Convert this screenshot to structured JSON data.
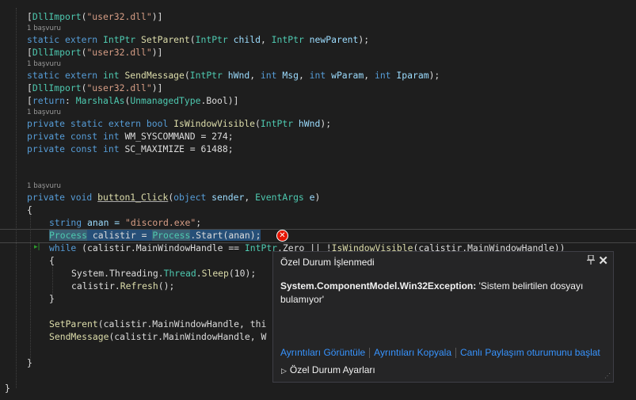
{
  "code": {
    "l1": {
      "b1": "[",
      "attr": "DllImport",
      "b2": "(",
      "str": "\"user32.dll\"",
      "b3": ")]"
    },
    "r1": "1 başvuru",
    "l2": {
      "kw": "static extern ",
      "ty": "IntPtr ",
      "fn": "SetParent",
      "a": "(",
      "t1": "IntPtr",
      "p1": " child",
      "c": ", ",
      "t2": "IntPtr",
      "p2": " newParent",
      "e": ");"
    },
    "l3": {
      "b1": "[",
      "attr": "DllImport",
      "b2": "(",
      "str": "\"user32.dll\"",
      "b3": ")]"
    },
    "r2": "1 başvuru",
    "l4": {
      "kw": "static extern ",
      "ty": "int ",
      "fn": "SendMessage",
      "a": "(",
      "t1": "IntPtr",
      "p1": " hWnd",
      "c1": ", ",
      "t2": "int",
      "p2": " Msg",
      "c2": ", ",
      "t3": "int",
      "p3": " wParam",
      "c3": ", ",
      "t4": "int",
      "p4": " Iparam",
      "e": ");"
    },
    "l5": {
      "b1": "[",
      "attr": "DllImport",
      "b2": "(",
      "str": "\"user32.dll\"",
      "b3": ")]"
    },
    "l6": {
      "b1": "[",
      "kw": "return",
      "c": ": ",
      "attr": "MarshalAs",
      "b2": "(",
      "ty": "UnmanagedType",
      "d": ".Bool)]"
    },
    "r3": "1 başvuru",
    "l7": {
      "kw": "private static extern bool ",
      "fn": "IsWindowVisible",
      "a": "(",
      "ty": "IntPtr",
      "p": " hWnd",
      "e": ");"
    },
    "l8": {
      "kw": "private const int ",
      "rest": "WM_SYSCOMMAND = 274;"
    },
    "l9": {
      "kw": "private const int ",
      "rest": "SC_MAXIMIZE = 61488;"
    },
    "r4": "1 başvuru",
    "l10": {
      "kw": "private void ",
      "fn": "button1_Click",
      "a": "(",
      "t1": "object",
      "p1": " sender",
      "c": ", ",
      "t2": "EventArgs",
      "p2": " e",
      "e": ")"
    },
    "l11": "{",
    "l12": {
      "kw": "string ",
      "v": "anan = ",
      "str": "\"discord.exe\"",
      "e": ";"
    },
    "l13": {
      "ty1": "Process",
      "v": " calistir = ",
      "ty2": "Process",
      "m": ".Start(anan);"
    },
    "l14": {
      "kw": "while ",
      "a": "(calistir.MainWindowHandle == ",
      "ty": "IntPtr",
      "b": ".Zero || !",
      "fn": "IsWindowVisible",
      "c": "(calistir.MainWindowHandle))"
    },
    "l15": "{",
    "l16": {
      "a": "System.Threading.",
      "ty": "Thread",
      "b": ".",
      "fn": "Sleep",
      "c": "(10);"
    },
    "l17": {
      "a": "calistir.",
      "fn": "Refresh",
      "b": "();"
    },
    "l18": "}",
    "l19": {
      "fn": "SetParent",
      "a": "(calistir.MainWindowHandle, thi"
    },
    "l20": {
      "fn": "SendMessage",
      "a": "(calistir.MainWindowHandle, W"
    },
    "l21": "}",
    "l22": "}"
  },
  "error_glyph": "✕",
  "run_to_click_glyph": "▸|",
  "exception_popup": {
    "title": "Özel Durum İşlenmedi",
    "exception_type": "System.ComponentModel.Win32Exception:",
    "exception_message": " 'Sistem belirtilen dosyayı bulamıyor'",
    "links": [
      "Ayrıntıları Görüntüle",
      "Ayrıntıları Kopyala",
      "Canlı Paylaşım oturumunu başlat"
    ],
    "settings_label": "Özel Durum Ayarları",
    "pin_glyph": "📌",
    "close_glyph": "✕"
  },
  "colors": {
    "background": "#1e1e1e",
    "keyword": "#569cd6",
    "type": "#4ec9b0",
    "method": "#dcdcaa",
    "string": "#d69d85",
    "param": "#9cdcfe",
    "error": "#e51400",
    "link": "#3794ff"
  }
}
